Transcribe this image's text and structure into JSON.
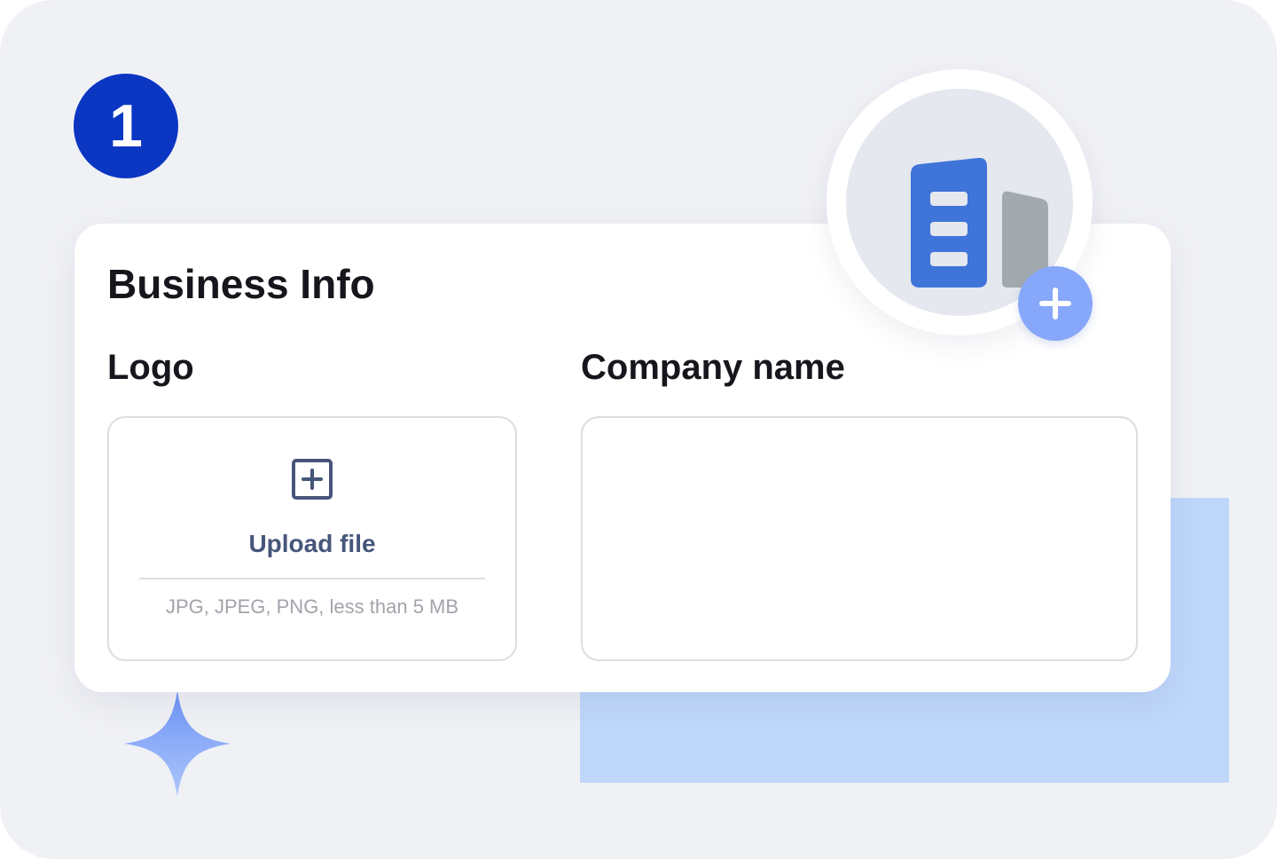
{
  "step": {
    "number": "1",
    "color": "#0a36c2"
  },
  "card": {
    "title": "Business Info"
  },
  "logo_field": {
    "label": "Logo",
    "upload_icon": "plus-square-icon",
    "upload_label": "Upload file",
    "hint": "JPG, JPEG, PNG, less than 5 MB"
  },
  "company_field": {
    "label": "Company name",
    "value": "",
    "placeholder": ""
  },
  "building_badge": {
    "icon": "building-icon",
    "action_icon": "plus-icon",
    "accent": "#3f74d8",
    "secondary": "#a3aaae",
    "button_color": "#86a7fa"
  },
  "decor": {
    "sparkle_icon": "sparkle-icon",
    "background_block_color": "#bfd7fb"
  }
}
